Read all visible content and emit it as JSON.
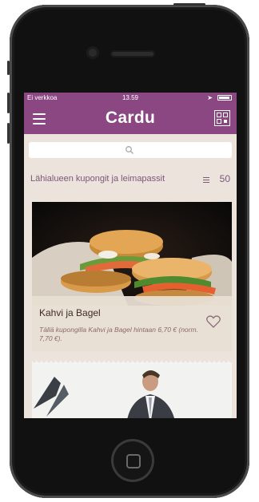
{
  "status_bar": {
    "carrier": "Ei verkkoa",
    "time": "13.59"
  },
  "app": {
    "logo_text": "Cardu"
  },
  "section": {
    "title": "Lähialueen kupongit ja leimapassit",
    "count": "50"
  },
  "cards": [
    {
      "title": "Kahvi ja Bagel",
      "description": "Tällä kupongilla Kahvi ja Bagel hintaan 6,70 € (norm. 7,70 €)."
    }
  ],
  "colors": {
    "brand": "#8b4782",
    "background": "#ece3dc",
    "section_text": "#7a5876"
  },
  "icons": {
    "menu": "hamburger-icon",
    "qr": "qr-code-icon",
    "search": "search-icon",
    "list": "list-icon",
    "favorite": "heart-icon"
  }
}
